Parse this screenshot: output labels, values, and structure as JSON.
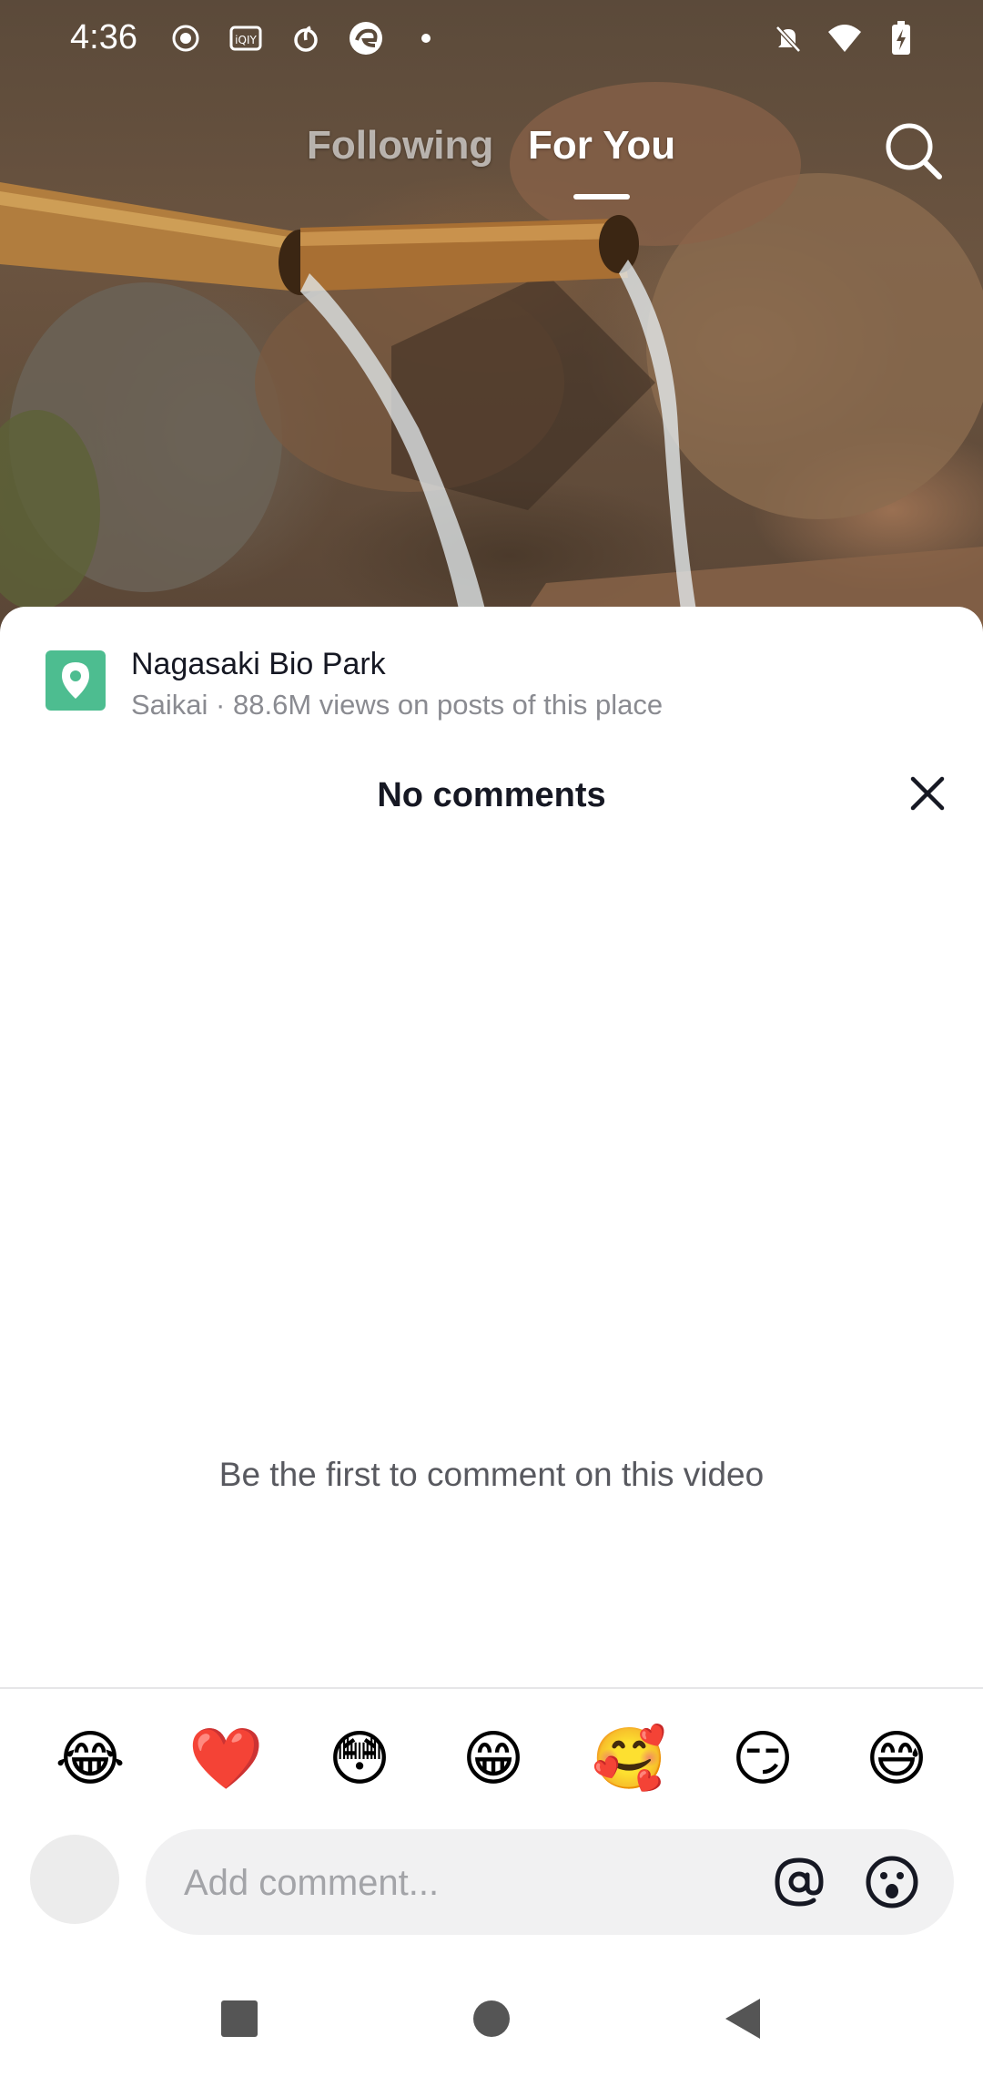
{
  "status_bar": {
    "time": "4:36",
    "left_icons": [
      "record-icon",
      "iqiyi-icon",
      "netease-music-icon",
      "edge-browser-icon",
      "dot-icon"
    ],
    "right_icons": [
      "bell-off-icon",
      "wifi-icon",
      "battery-charging-icon"
    ]
  },
  "top_tabs": {
    "following": "Following",
    "for_you": "For You",
    "active": "for_you"
  },
  "place": {
    "name": "Nagasaki Bio Park",
    "subtitle": "Saikai · 88.6M views on posts of this place",
    "icon": "location-pin-icon",
    "icon_color": "#4dbd90"
  },
  "comments": {
    "title": "No comments",
    "empty_message": "Be the first to comment on this video"
  },
  "quick_emojis": [
    "😂",
    "❤️",
    "😳",
    "😁",
    "🥰",
    "😏",
    "😅"
  ],
  "composer": {
    "placeholder": "Add comment...",
    "mention_icon": "at-icon",
    "emoji_icon": "smiley-icon"
  },
  "nav": [
    "recents-square-icon",
    "home-circle-icon",
    "back-triangle-icon"
  ]
}
